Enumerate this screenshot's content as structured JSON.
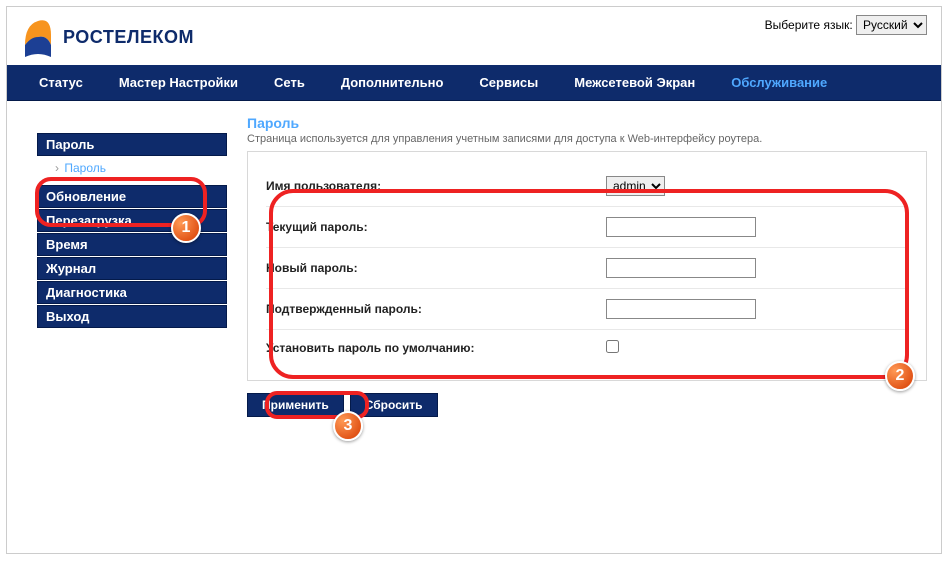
{
  "lang": {
    "label": "Выберите язык:",
    "selected": "Русский"
  },
  "brand": "РОСТЕЛЕКОМ",
  "nav": {
    "status": "Статус",
    "wizard": "Мастер Настройки",
    "network": "Сеть",
    "advanced": "Дополнительно",
    "services": "Сервисы",
    "firewall": "Межсетевой Экран",
    "maint": "Обслуживание"
  },
  "sidebar": {
    "password": "Пароль",
    "password_sub": "Пароль",
    "update": "Обновление",
    "reboot": "Перезагрузка",
    "time": "Время",
    "log": "Журнал",
    "diag": "Диагностика",
    "exit": "Выход"
  },
  "page": {
    "title": "Пароль",
    "desc": "Страница используется для управления учетным записями для доступа к Web-интерфейсу роутера."
  },
  "form": {
    "username_label": "Имя пользователя:",
    "username_value": "admin",
    "current_label": "Текущий пароль:",
    "new_label": "Новый пароль:",
    "confirm_label": "Подтвержденный пароль:",
    "default_label": "Установить пароль по умолчанию:"
  },
  "buttons": {
    "apply": "Применить",
    "reset": "Сбросить"
  },
  "badges": {
    "b1": "1",
    "b2": "2",
    "b3": "3"
  }
}
